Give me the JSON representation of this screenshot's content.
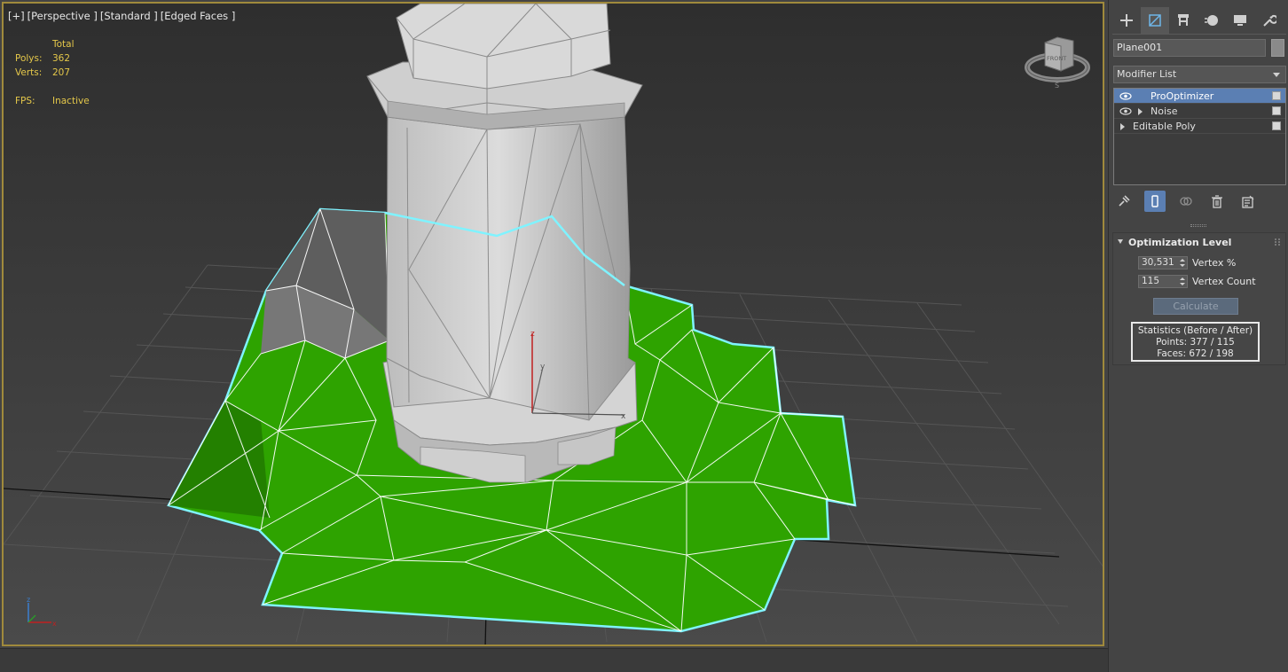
{
  "viewport": {
    "labels": [
      "[+]",
      "[Perspective ]",
      "[Standard ]",
      "[Edged Faces ]"
    ],
    "stats": {
      "header": "Total",
      "polys_label": "Polys:",
      "polys_value": "362",
      "verts_label": "Verts:",
      "verts_value": "207",
      "fps_label": "FPS:",
      "fps_value": "Inactive"
    },
    "viewcube_label": "FRONT",
    "gizmo_axes": [
      "z",
      "y",
      "x"
    ]
  },
  "colors": {
    "viewport_border": "#a08a3c",
    "ground_green": "#2ea300",
    "selection_outline": "#7ff3ff",
    "stats_yellow": "#e5c84a",
    "selection_blue": "#5b7fb3"
  },
  "command_panel": {
    "tabs": [
      "create-icon",
      "modify-icon",
      "hierarchy-icon",
      "motion-icon",
      "display-icon",
      "utilities-icon"
    ],
    "object_name": "Plane001",
    "modifier_list_label": "Modifier List",
    "stack": [
      {
        "label": "ProOptimizer",
        "selected": true,
        "has_eye": true,
        "expandable": false
      },
      {
        "label": "Noise",
        "selected": false,
        "has_eye": true,
        "expandable": true
      },
      {
        "label": "Editable Poly",
        "selected": false,
        "has_eye": false,
        "expandable": true
      }
    ],
    "stack_tools": [
      "pin-stack-icon",
      "show-end-result-icon",
      "make-unique-icon",
      "remove-modifier-icon",
      "configure-modifier-sets-icon"
    ],
    "rollout": {
      "title": "Optimization Level",
      "vertex_percent_value": "30,531",
      "vertex_percent_label": "Vertex %",
      "vertex_count_value": "115",
      "vertex_count_label": "Vertex Count",
      "calculate_label": "Calculate",
      "statistics_title": "Statistics (Before / After)",
      "points_line": "Points: 377 / 115",
      "faces_line": "Faces: 672 / 198"
    }
  }
}
